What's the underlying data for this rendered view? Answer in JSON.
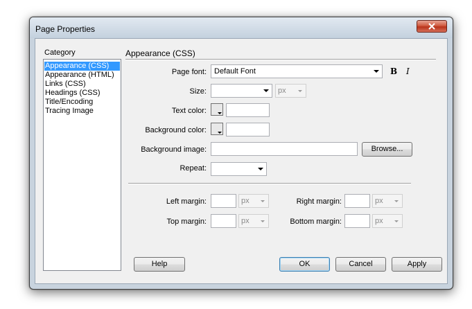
{
  "window": {
    "title": "Page Properties",
    "close_label": "x"
  },
  "category": {
    "label": "Category",
    "items": [
      {
        "label": "Appearance (CSS)",
        "selected": true
      },
      {
        "label": "Appearance (HTML)",
        "selected": false
      },
      {
        "label": "Links (CSS)",
        "selected": false
      },
      {
        "label": "Headings (CSS)",
        "selected": false
      },
      {
        "label": "Title/Encoding",
        "selected": false
      },
      {
        "label": "Tracing Image",
        "selected": false
      }
    ]
  },
  "section": {
    "title": "Appearance (CSS)"
  },
  "form": {
    "page_font": {
      "label": "Page font:",
      "value": "Default Font",
      "bold": "B",
      "italic": "I"
    },
    "size": {
      "label": "Size:",
      "value": "",
      "unit": "px"
    },
    "text_color": {
      "label": "Text color:",
      "value": ""
    },
    "background_color": {
      "label": "Background color:",
      "value": ""
    },
    "background_image": {
      "label": "Background image:",
      "value": "",
      "browse": "Browse..."
    },
    "repeat": {
      "label": "Repeat:",
      "value": ""
    },
    "left_margin": {
      "label": "Left margin:",
      "value": "",
      "unit": "px"
    },
    "right_margin": {
      "label": "Right margin:",
      "value": "",
      "unit": "px"
    },
    "top_margin": {
      "label": "Top margin:",
      "value": "",
      "unit": "px"
    },
    "bottom_margin": {
      "label": "Bottom margin:",
      "value": "",
      "unit": "px"
    }
  },
  "buttons": {
    "help": "Help",
    "ok": "OK",
    "cancel": "Cancel",
    "apply": "Apply"
  },
  "colors": {
    "selection": "#3399ff",
    "dialog_frame": "#c8d3de",
    "close_button": "#c9442b"
  }
}
